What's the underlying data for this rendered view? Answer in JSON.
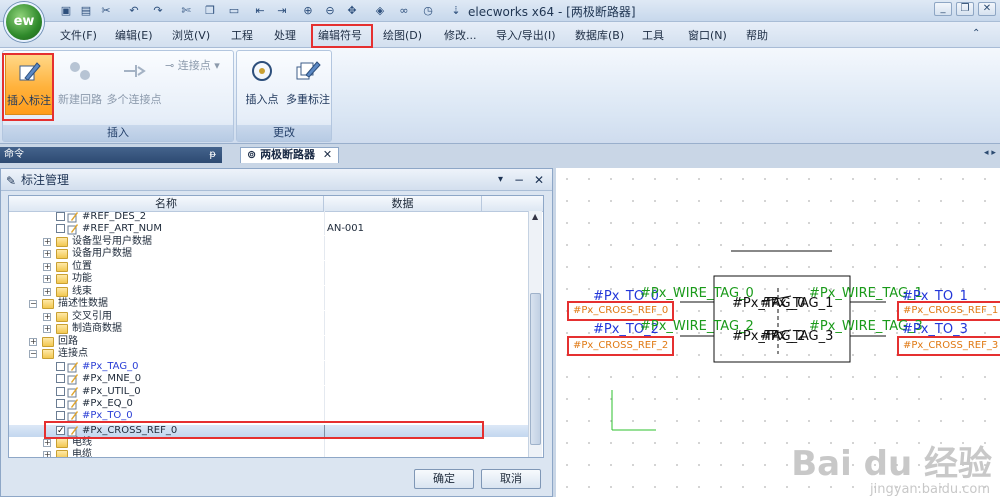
{
  "window": {
    "title": "elecworks x64 - [两极断路器]",
    "orb_label": "ew"
  },
  "quick_access": [
    "save-icon",
    "disk-icon",
    "cut-icon",
    "undo-icon",
    "redo-icon",
    "scissors-icon",
    "copy-icon",
    "paste-icon",
    "import-icon",
    "export-icon",
    "zoom-icon",
    "zoom-out-icon",
    "pan-icon",
    "run-icon",
    "binoculars-icon",
    "clock-icon"
  ],
  "menu": {
    "items": [
      "文件(F)",
      "编辑(E)",
      "浏览(V)",
      "工程",
      "处理",
      "编辑符号",
      "绘图(D)",
      "修改...",
      "导入/导出(I)",
      "数据库(B)",
      "工具",
      "窗口(N)",
      "帮助"
    ],
    "active": "编辑符号"
  },
  "ribbon": {
    "group_insert": {
      "label": "插入",
      "insert_tag": "插入标注",
      "new_circuit": "新建回路",
      "multi_connect": "多个连接点",
      "connect_point": "连接点"
    },
    "group_change": {
      "label": "更改",
      "insert_point": "插入点",
      "multi_tag": "多重标注"
    }
  },
  "panels": {
    "command_title": "命令",
    "doc_tab": "两极断路器"
  },
  "dialog": {
    "title": "标注管理",
    "col_name": "名称",
    "col_data": "数据",
    "rows": [
      {
        "label": "#REF_DES_2",
        "data": ""
      },
      {
        "label": "#REF_ART_NUM",
        "data": "AN-001"
      },
      {
        "label": "设备型号用户数据",
        "data": ""
      },
      {
        "label": "设备用户数据",
        "data": ""
      },
      {
        "label": "位置",
        "data": ""
      },
      {
        "label": "功能",
        "data": ""
      },
      {
        "label": "线束",
        "data": ""
      },
      {
        "label": "描述性数据",
        "data": ""
      },
      {
        "label": "交叉引用",
        "data": ""
      },
      {
        "label": "制造商数据",
        "data": ""
      },
      {
        "label": "回路",
        "data": ""
      },
      {
        "label": "连接点",
        "data": ""
      },
      {
        "label": "#Px_TAG_0",
        "data": ""
      },
      {
        "label": "#Px_MNE_0",
        "data": ""
      },
      {
        "label": "#Px_UTIL_0",
        "data": ""
      },
      {
        "label": "#Px_EQ_0",
        "data": ""
      },
      {
        "label": "#Px_TO_0",
        "data": ""
      },
      {
        "label": "#Px_CROSS_REF_0",
        "data": ""
      },
      {
        "label": "电线",
        "data": ""
      },
      {
        "label": "电缆",
        "data": ""
      }
    ],
    "ok": "确定",
    "cancel": "取消"
  },
  "canvas": {
    "to0": "#Px_TO_0",
    "wire0": "#Px_WIRE_TAG_0",
    "tag0": "#Px_TAG_0",
    "wire1": "#Px_WIRE_TAG_1",
    "to1": "#Px_TO_1",
    "xref0": "#Px_CROSS_REF_0",
    "xref1": "#Px_CROSS_REF_1",
    "to2": "#Px_TO_2",
    "wire2": "#Px_WIRE_TAG_2",
    "tag2": "#Px_TAG_2",
    "wire3": "#Px_WIRE_TAG_3",
    "to3": "#Px_TO_3",
    "xref2": "#Px_CROSS_REF_2",
    "xref3": "#Px_CROSS_REF_3",
    "tag1": "#Px_TAG_1",
    "tag3": "#Px_TAG_3"
  },
  "watermark": {
    "brand": "Bai du 经验",
    "url": "jingyan.baidu.com"
  },
  "colors": {
    "accent_red": "#e53030",
    "pin_blue": "#2236d9",
    "wire_green": "#1a9a1a",
    "xref_orange": "#e07a14"
  }
}
